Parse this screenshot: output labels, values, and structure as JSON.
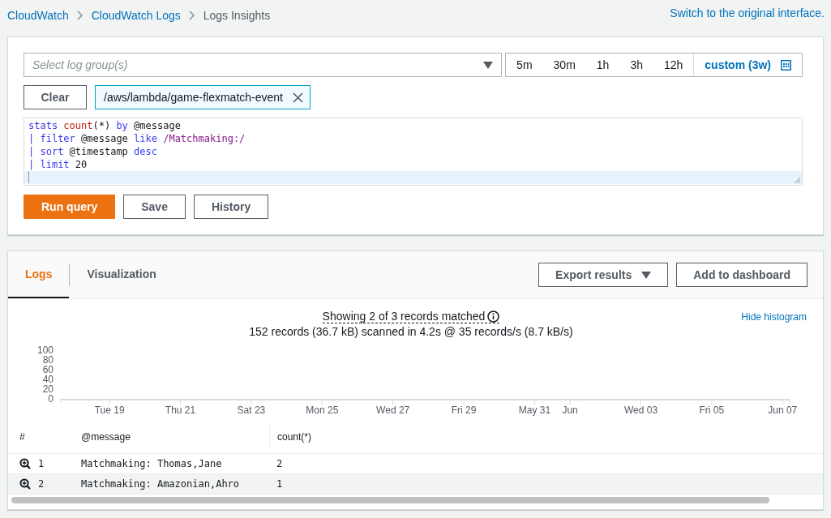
{
  "breadcrumb": [
    {
      "label": "CloudWatch",
      "kind": "link"
    },
    {
      "label": "CloudWatch Logs",
      "kind": "link"
    },
    {
      "label": "Logs Insights",
      "kind": "current"
    }
  ],
  "switch_link": "Switch to the original interface.",
  "query": {
    "log_group_placeholder": "Select log group(s)",
    "time_ranges": [
      {
        "label": "5m",
        "selected": false
      },
      {
        "label": "30m",
        "selected": false
      },
      {
        "label": "1h",
        "selected": false
      },
      {
        "label": "3h",
        "selected": false
      },
      {
        "label": "12h",
        "selected": false
      },
      {
        "label": "custom (3w)",
        "selected": true
      }
    ],
    "clear_button": "Clear",
    "selected_group": "/aws/lambda/game-flexmatch-event",
    "code_lines": [
      [
        {
          "kind": "keyword",
          "text": "stats "
        },
        {
          "kind": "function",
          "text": "count"
        },
        {
          "kind": "plain",
          "text": "(*) "
        },
        {
          "kind": "keyword",
          "text": "by"
        },
        {
          "kind": "plain",
          "text": " @message"
        }
      ],
      [
        {
          "kind": "pipe",
          "text": "| "
        },
        {
          "kind": "keyword",
          "text": "filter"
        },
        {
          "kind": "plain",
          "text": " @message "
        },
        {
          "kind": "keyword",
          "text": "like "
        },
        {
          "kind": "regex",
          "text": "/Matchmaking:/"
        }
      ],
      [
        {
          "kind": "pipe",
          "text": "| "
        },
        {
          "kind": "keyword",
          "text": "sort"
        },
        {
          "kind": "plain",
          "text": " @timestamp "
        },
        {
          "kind": "keyword",
          "text": "desc"
        }
      ],
      [
        {
          "kind": "pipe",
          "text": "| "
        },
        {
          "kind": "keyword",
          "text": "limit"
        },
        {
          "kind": "plain",
          "text": " 20"
        }
      ]
    ],
    "buttons": [
      {
        "label": "Run query",
        "kind": "primary"
      },
      {
        "label": "Save",
        "kind": "normal"
      },
      {
        "label": "History",
        "kind": "normal"
      }
    ]
  },
  "results": {
    "tabs": [
      {
        "label": "Logs",
        "selected": true
      },
      {
        "label": "Visualization",
        "selected": false
      }
    ],
    "export_button": "Export results",
    "dashboard_button": "Add to dashboard",
    "summary": "Showing 2 of 3 records matched",
    "scanned": "152 records (36.7 kB) scanned in 4.2s @ 35 records/s (8.7 kB/s)",
    "hide_histogram": "Hide histogram",
    "chart_data": {
      "type": "bar",
      "ylim": [
        0,
        100
      ],
      "yticks": [
        0,
        20,
        40,
        60,
        80,
        100
      ],
      "categories": [
        null,
        "Tue 19",
        null,
        "Thu 21",
        null,
        "Sat 23",
        null,
        "Mon 25",
        null,
        "Wed 27",
        null,
        "Fri 29",
        null,
        "May 31",
        "Jun",
        null,
        "Wed 03",
        null,
        "Fri 05",
        null,
        "Jun 07"
      ]
    },
    "table": {
      "columns": [
        "#",
        "@message",
        "count(*)"
      ],
      "rows": [
        {
          "index": "1",
          "message": "Matchmaking: Thomas,Jane",
          "count": "2"
        },
        {
          "index": "2",
          "message": "Matchmaking: Amazonian,Ahro",
          "count": "1"
        }
      ]
    }
  }
}
